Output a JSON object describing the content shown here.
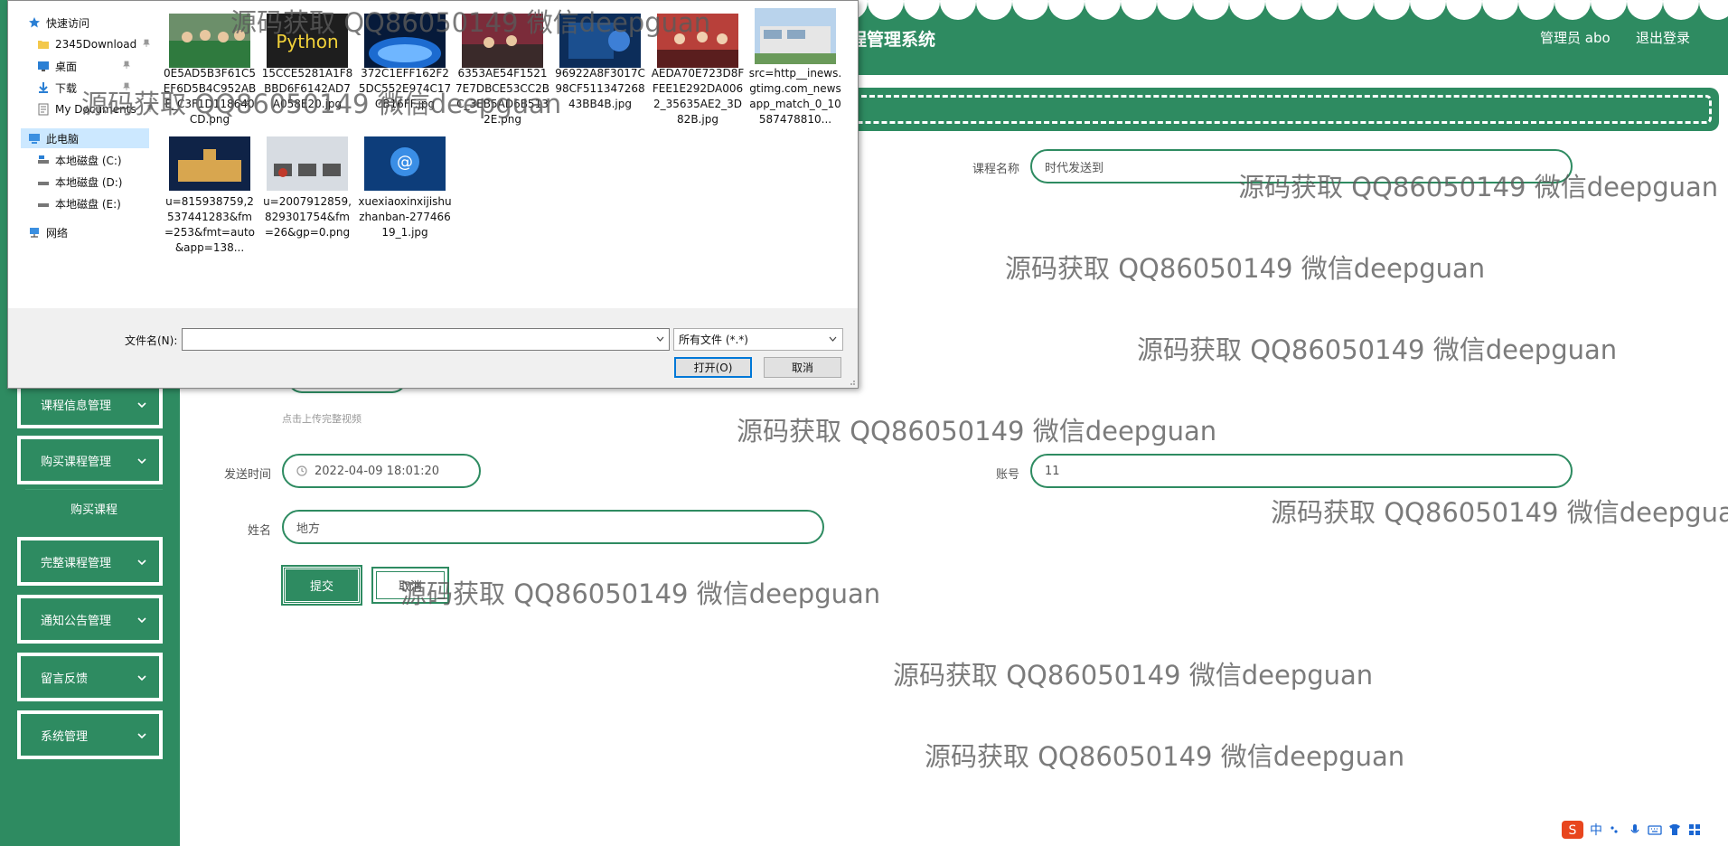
{
  "header": {
    "title": "程管理系统",
    "user": "管理员 abo",
    "logout": "退出登录"
  },
  "colors": {
    "brand": "#2e8b61",
    "white": "#ffffff",
    "dialog_bg": "#f0f0f0",
    "selected": "#cce8ff"
  },
  "sidebar": {
    "items": [
      {
        "label": "课程信息管理"
      },
      {
        "label": "购买课程管理"
      },
      {
        "label": "完整课程管理"
      },
      {
        "label": "通知公告管理"
      },
      {
        "label": "留言反馈"
      },
      {
        "label": "系统管理"
      }
    ],
    "submenu": {
      "label": "购买课程"
    }
  },
  "form": {
    "course_name_label": "课程名称",
    "course_name_value": "时代发送到",
    "upload_hint": "点击上传完整视频",
    "send_time_label": "发送时间",
    "send_time_value": "2022-04-09 18:01:20",
    "account_label": "账号",
    "account_value": "11",
    "name_label": "姓名",
    "name_value": "地方",
    "submit": "提交",
    "cancel": "取消"
  },
  "watermark": "源码获取 QQ86050149 微信deepguan",
  "dialog": {
    "nav": [
      {
        "label": "快速访问",
        "icon": "star-icon"
      },
      {
        "label": "2345Download",
        "icon": "folder-icon",
        "pinned": true
      },
      {
        "label": "桌面",
        "icon": "desktop-icon",
        "pinned": true
      },
      {
        "label": "下载",
        "icon": "download-icon",
        "pinned": true
      },
      {
        "label": "My Documents",
        "icon": "document-icon",
        "pinned": true
      },
      {
        "label": "此电脑",
        "icon": "computer-icon"
      },
      {
        "label": "本地磁盘 (C:)",
        "icon": "drive-icon"
      },
      {
        "label": "本地磁盘 (D:)",
        "icon": "drive-icon"
      },
      {
        "label": "本地磁盘 (E:)",
        "icon": "drive-icon"
      },
      {
        "label": "网络",
        "icon": "network-icon"
      }
    ],
    "files": [
      {
        "name": "0E5AD5B3F61C5EF6D5B4C952ABE_C3F1D118640CD.png",
        "thumb": "people-photo"
      },
      {
        "name": "15CCE5281A1F8BBD6F6142AD7A058E20.jpg",
        "thumb": "python-logo"
      },
      {
        "name": "372C1EFF162F25DC552E974C17CB16FF.jpg",
        "thumb": "tech-globe"
      },
      {
        "name": "6353AE54F15217E7DBCE53CC2BC_3EB5AD6B5132E.png",
        "thumb": "group-photo"
      },
      {
        "name": "96922A8F3017C98CF51134726843BB4B.jpg",
        "thumb": "code-screen"
      },
      {
        "name": "AEDA70E723D8FFEE1E292DA0062_35635AE2_3D82B.jpg",
        "thumb": "stage-photo"
      },
      {
        "name": "src=http__inews.gtimg.com_newsapp_match_0_10587478810...",
        "thumb": "building-photo"
      },
      {
        "name": "u=815938759,2537441283&fm=253&fmt=auto&app=138...",
        "thumb": "night-building"
      },
      {
        "name": "u=2007912859,829301754&fm=26&gp=0.png",
        "thumb": "classroom-photo"
      },
      {
        "name": "xuexiaoxinxijishuzhanban-27746619_1.jpg",
        "thumb": "hands-at-icon"
      }
    ],
    "filename_label": "文件名(N):",
    "filename_value": "",
    "filter_value": "所有文件 (*.*)",
    "open": "打开(O)",
    "cancel": "取消"
  },
  "tray": {
    "ime": "中"
  }
}
